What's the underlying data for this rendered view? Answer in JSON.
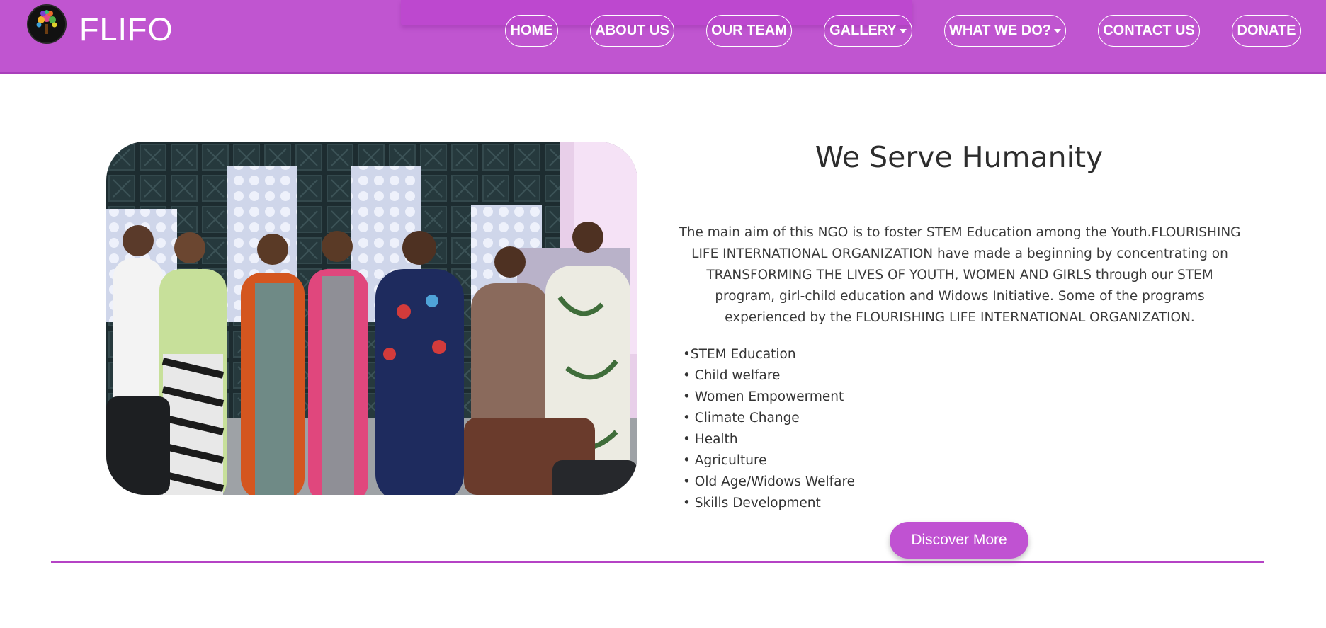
{
  "header": {
    "brand": "FLIFO",
    "nav": [
      {
        "label": "HOME"
      },
      {
        "label": "ABOUT US"
      },
      {
        "label": "OUR TEAM"
      },
      {
        "label": "GALLERY",
        "dropdown": true
      },
      {
        "label": "WHAT WE DO?",
        "dropdown": true
      },
      {
        "label": "CONTACT US"
      },
      {
        "label": "DONATE"
      }
    ]
  },
  "main": {
    "title": "We Serve Humanity",
    "paragraph": "The main aim of this NGO is to foster STEM Education among the Youth.FLOURISHING LIFE INTERNATIONAL ORGANIZATION have made a beginning by concentrating on TRANSFORMING THE LIVES OF YOUTH, WOMEN AND GIRLS through our STEM program, girl-child education and Widows Initiative. Some of the programs experienced by the FLOURISHING LIFE INTERNATIONAL ORGANIZATION.",
    "programs": [
      "•STEM Education",
      "• Child welfare",
      "• Women Empowerment",
      "• Climate Change",
      "• Health",
      "• Agriculture",
      "• Old Age/Widows Welfare",
      "• Skills Development"
    ],
    "cta": "Discover More"
  },
  "colors": {
    "header": "#c055d0",
    "accent": "#c052d2",
    "divider": "#b543c5"
  }
}
